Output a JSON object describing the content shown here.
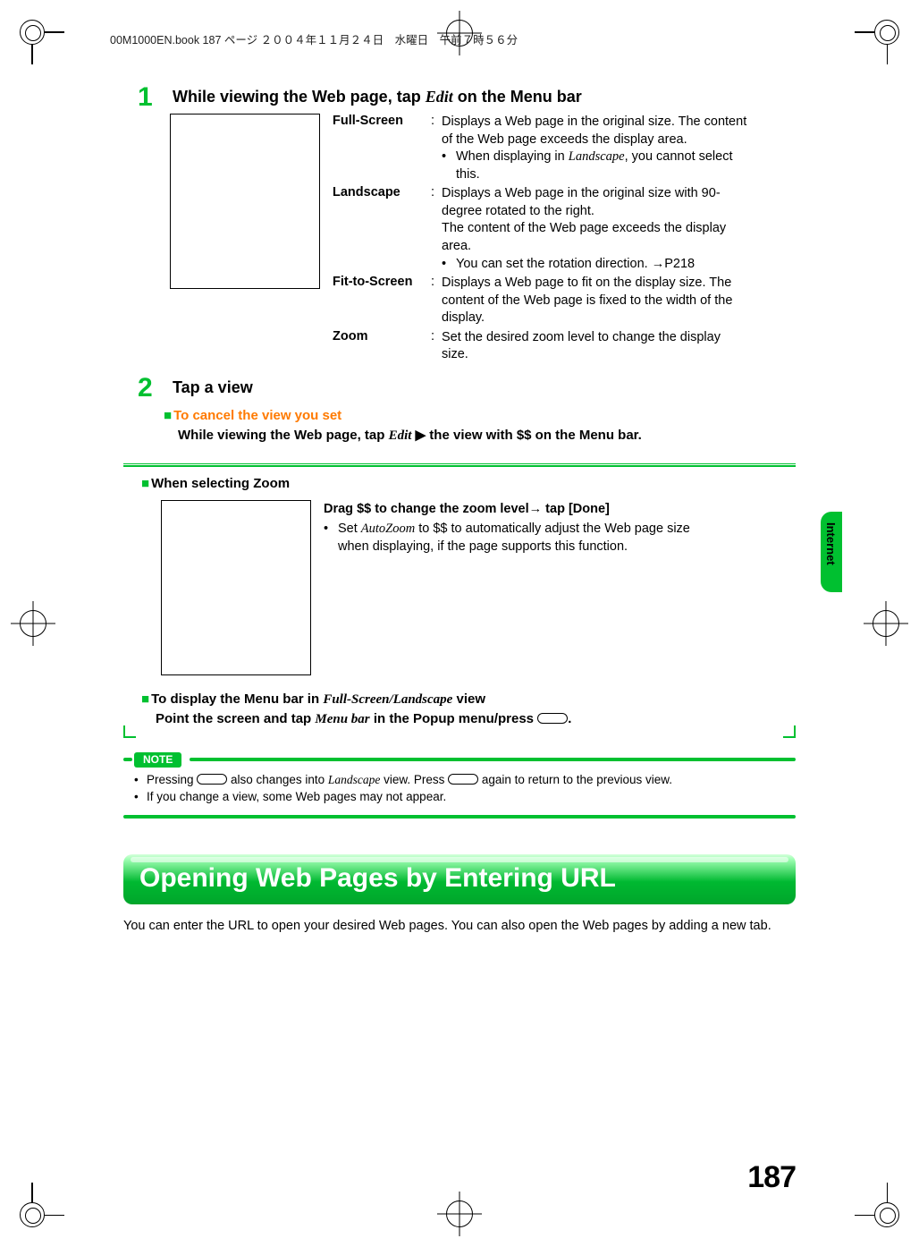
{
  "header_line": "00M1000EN.book  187 ページ  ２００４年１１月２４日　水曜日　午前７時５６分",
  "page_number": "187",
  "side_tab": "Internet",
  "step1": {
    "num": "1",
    "title_a": "While viewing the Web page, tap ",
    "title_em": "Edit",
    "title_b": " on the Menu bar",
    "defs": [
      {
        "term": "Full-Screen",
        "desc": "Displays a Web page in the original size. The content of the Web page exceeds the display area.",
        "sub": "When displaying in ",
        "sub_em": "Landscape",
        "sub_b": ", you cannot select this."
      },
      {
        "term": "Landscape",
        "desc": "Displays a Web page in the original size with 90-degree rotated to the right.\nThe content of the Web page exceeds the display area.",
        "sub": "You can set the rotation direction. →P218"
      },
      {
        "term": "Fit-to-Screen",
        "desc": "Displays a Web page to fit on the display size. The content of the Web page is fixed to the width of the display."
      },
      {
        "term": "Zoom",
        "desc": "Set the desired zoom level to change the display size."
      }
    ]
  },
  "step2": {
    "num": "2",
    "title": "Tap a view",
    "cancel_hdr": "To cancel the view you set",
    "cancel_body_a": "While viewing the Web page, tap ",
    "cancel_body_em": "Edit",
    "cancel_body_b": " ▶ the view with $$ on the Menu bar."
  },
  "zoom": {
    "hdr": "When selecting Zoom",
    "line1": "Drag $$ to change the zoom level→ tap [Done]",
    "bullet_a": "Set ",
    "bullet_em": "AutoZoom",
    "bullet_b": " to $$ to automatically adjust the Web page size when displaying, if the page supports this function."
  },
  "menubar": {
    "hdr_a": "To display the Menu bar in ",
    "hdr_em": "Full-Screen/Landscape",
    "hdr_b": " view",
    "body_a": "Point the screen and tap ",
    "body_em": "Menu bar",
    "body_b": " in the Popup menu/press ",
    "body_c": "."
  },
  "note": {
    "label": "NOTE",
    "items": [
      {
        "a": "Pressing ",
        "mid": " also changes into ",
        "em": "Landscape",
        "b": " view. Press ",
        "c": " again to return to the previous view."
      },
      {
        "text": "If you change a view, some Web pages may not appear."
      }
    ]
  },
  "big_heading": "Opening Web Pages by Entering URL",
  "para": "You can enter the URL to open your desired Web pages. You can also open the Web pages by adding a new tab."
}
